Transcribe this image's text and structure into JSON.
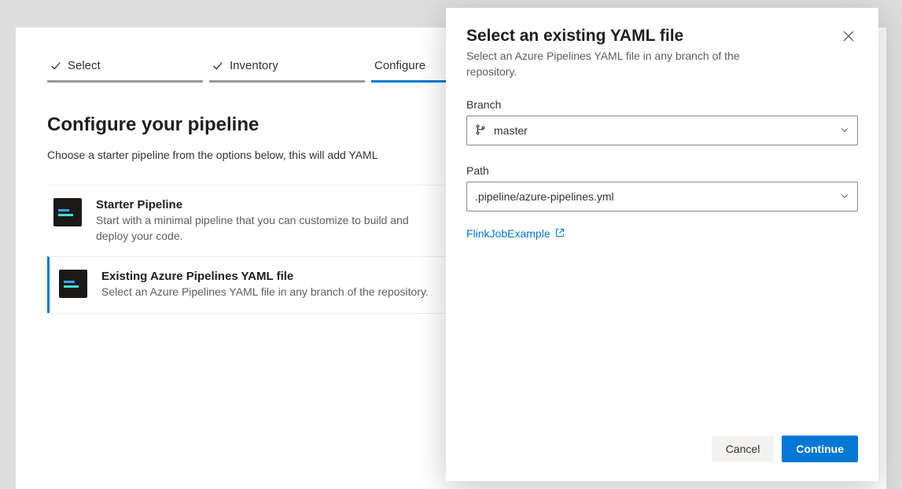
{
  "wizard": {
    "steps": [
      {
        "label": "Select",
        "done": true,
        "current": false
      },
      {
        "label": "Inventory",
        "done": true,
        "current": false
      },
      {
        "label": "Configure",
        "done": false,
        "current": true
      }
    ]
  },
  "page": {
    "title": "Configure your pipeline",
    "subtitle": "Choose a starter pipeline from the options below, this will add YAML"
  },
  "options": [
    {
      "title": "Starter Pipeline",
      "desc": "Start with a minimal pipeline that you can customize to build and deploy your code.",
      "selected": false
    },
    {
      "title": "Existing Azure Pipelines YAML file",
      "desc": "Select an Azure Pipelines YAML file in any branch of the repository.",
      "selected": true
    }
  ],
  "dialog": {
    "title": "Select an existing YAML file",
    "subtitle": "Select an Azure Pipelines YAML file in any branch of the repository.",
    "branch": {
      "label": "Branch",
      "value": "master"
    },
    "path": {
      "label": "Path",
      "value": ".pipeline/azure-pipelines.yml"
    },
    "link": {
      "label": "FlinkJobExample"
    },
    "cancel": "Cancel",
    "continue": "Continue"
  }
}
